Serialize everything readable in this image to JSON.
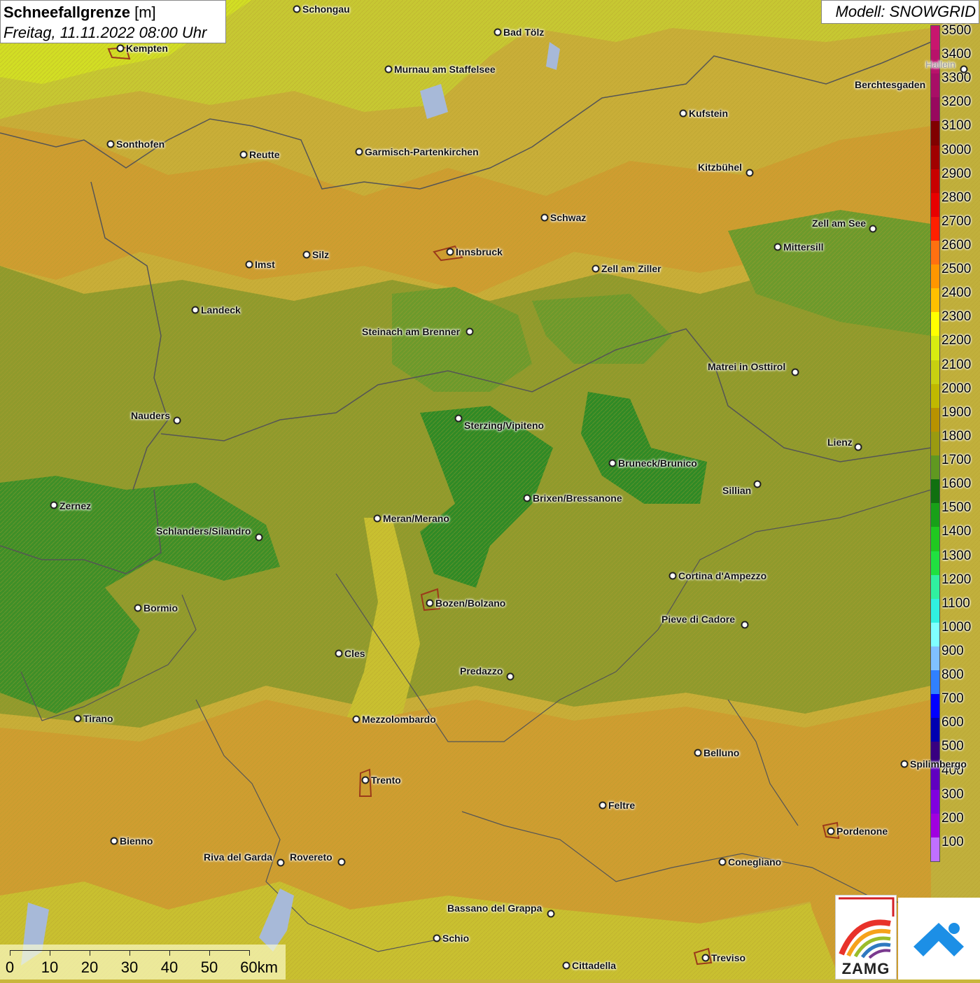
{
  "title": {
    "main": "Schneefallgrenze",
    "unit": "[m]",
    "date": "Freitag, 11.11.2022 08:00 Uhr"
  },
  "model": "Modell: SNOWGRID",
  "legend": [
    {
      "v": "3500",
      "c": "#c8166e"
    },
    {
      "v": "3400",
      "c": "#b8126a"
    },
    {
      "v": "3300",
      "c": "#a80e66"
    },
    {
      "v": "3200",
      "c": "#98085e"
    },
    {
      "v": "3100",
      "c": "#800000"
    },
    {
      "v": "3000",
      "c": "#a00000"
    },
    {
      "v": "2900",
      "c": "#c80000"
    },
    {
      "v": "2800",
      "c": "#e80000"
    },
    {
      "v": "2700",
      "c": "#ff2000"
    },
    {
      "v": "2600",
      "c": "#ff7010"
    },
    {
      "v": "2500",
      "c": "#ff9600"
    },
    {
      "v": "2400",
      "c": "#ffc000"
    },
    {
      "v": "2300",
      "c": "#ffff00"
    },
    {
      "v": "2200",
      "c": "#d8ec10"
    },
    {
      "v": "2100",
      "c": "#c8d010"
    },
    {
      "v": "2000",
      "c": "#c0b800"
    },
    {
      "v": "1900",
      "c": "#b89200"
    },
    {
      "v": "1800",
      "c": "#9a9a10"
    },
    {
      "v": "1700",
      "c": "#609820"
    },
    {
      "v": "1600",
      "c": "#107010"
    },
    {
      "v": "1500",
      "c": "#18a018"
    },
    {
      "v": "1400",
      "c": "#20c820"
    },
    {
      "v": "1300",
      "c": "#20e040"
    },
    {
      "v": "1200",
      "c": "#30f0a0"
    },
    {
      "v": "1100",
      "c": "#30f0e0"
    },
    {
      "v": "1000",
      "c": "#80ffff"
    },
    {
      "v": "900",
      "c": "#80c0ff"
    },
    {
      "v": "800",
      "c": "#3080ff"
    },
    {
      "v": "700",
      "c": "#0000ff"
    },
    {
      "v": "600",
      "c": "#0000b0"
    },
    {
      "v": "500",
      "c": "#380080"
    },
    {
      "v": "400",
      "c": "#6000c0"
    },
    {
      "v": "300",
      "c": "#8000e0"
    },
    {
      "v": "200",
      "c": "#a000e0"
    },
    {
      "v": "100",
      "c": "#c070ff"
    }
  ],
  "scale": {
    "labels": [
      "0",
      "10",
      "20",
      "30",
      "40",
      "50",
      "60km"
    ]
  },
  "logo": {
    "zamg": "ZAMG"
  },
  "cities": [
    "Schongau",
    "Kempten",
    "Bad Tölz",
    "Murnau am Staffelsee",
    "Hallein",
    "Berchtesgaden",
    "Kufstein",
    "Sonthofen",
    "Reutte",
    "Garmisch-Partenkirchen",
    "Kitzbühel",
    "Schwaz",
    "Zell am See",
    "Innsbruck",
    "Mittersill",
    "Imst",
    "Silz",
    "Zell am Ziller",
    "Landeck",
    "Steinach am Brenner",
    "Matrei in Osttirol",
    "Nauders",
    "Sterzing/Vipiteno",
    "Lienz",
    "Bruneck/Brunico",
    "Sillian",
    "Zernez",
    "Brixen/Bressanone",
    "Meran/Merano",
    "Schlanders/Silandro",
    "Cortina d'Ampezzo",
    "Bozen/Bolzano",
    "Bormio",
    "Pieve di Cadore",
    "Cles",
    "Predazzo",
    "Tirano",
    "Mezzolombardo",
    "Belluno",
    "Spilimbergo",
    "Trento",
    "Feltre",
    "Pordenone",
    "Bienno",
    "Riva del Garda",
    "Rovereto",
    "Conegliano",
    "Bassano del Grappa",
    "Schio",
    "Treviso",
    "Cittadella"
  ]
}
